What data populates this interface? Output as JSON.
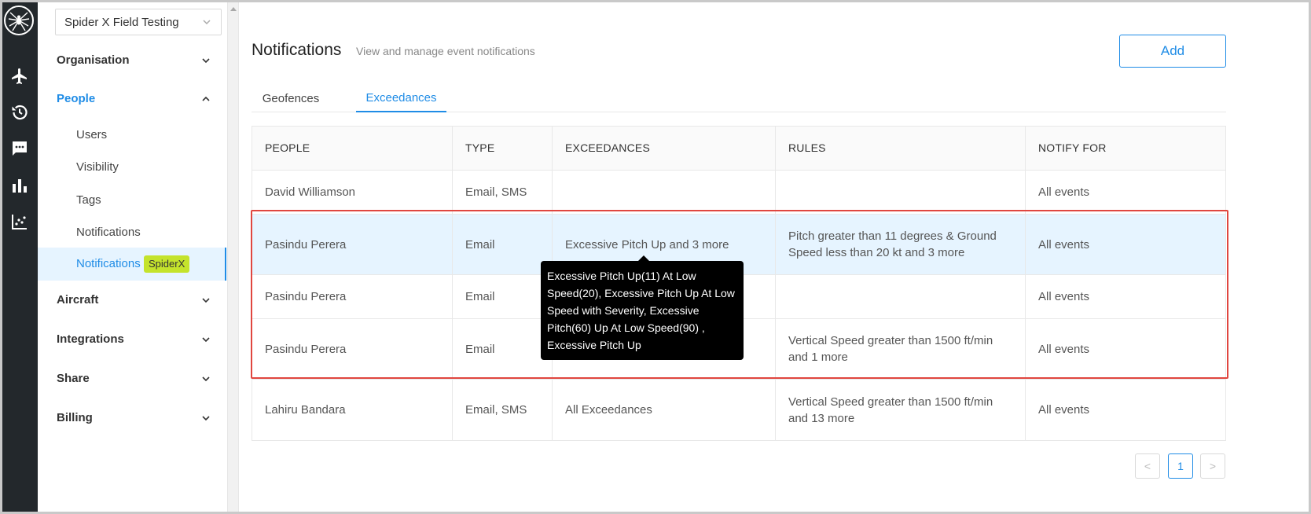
{
  "org_selector": {
    "value": "Spider X Field Testing"
  },
  "sidebar": {
    "groups": {
      "organisation": "Organisation",
      "people": "People",
      "aircraft": "Aircraft",
      "integrations": "Integrations",
      "share": "Share",
      "billing": "Billing"
    },
    "people_items": [
      "Users",
      "Visibility",
      "Tags",
      "Notifications"
    ],
    "active_item": {
      "label": "Notifications",
      "badge": "SpiderX"
    }
  },
  "rail_icons": [
    "spider-logo",
    "plane-icon",
    "history-icon",
    "chat-icon",
    "bar-chart-icon",
    "scatter-chart-icon"
  ],
  "header": {
    "title": "Notifications",
    "subtitle": "View and manage event notifications",
    "add_label": "Add"
  },
  "tabs": [
    {
      "label": "Geofences",
      "active": false
    },
    {
      "label": "Exceedances",
      "active": true
    }
  ],
  "table": {
    "columns": [
      "PEOPLE",
      "TYPE",
      "EXCEEDANCES",
      "RULES",
      "NOTIFY FOR"
    ],
    "rows": [
      {
        "people": "David Williamson",
        "type": "Email, SMS",
        "exceedances": "",
        "rules": "",
        "notify": "All events"
      },
      {
        "people": "Pasindu Perera",
        "type": "Email",
        "exceedances": "Excessive Pitch Up and 3 more",
        "rules": "Pitch greater than 11 degrees & Ground Speed less than 20 kt and 3 more",
        "notify": "All events"
      },
      {
        "people": "Pasindu Perera",
        "type": "Email",
        "exceedances": "",
        "rules": "",
        "notify": "All events"
      },
      {
        "people": "Pasindu Perera",
        "type": "Email",
        "exceedances": "",
        "rules": "Vertical Speed greater than 1500 ft/min and 1 more",
        "notify": "All events"
      },
      {
        "people": "Lahiru Bandara",
        "type": "Email, SMS",
        "exceedances": "All Exceedances",
        "rules": "Vertical Speed greater than 1500 ft/min and 13 more",
        "notify": "All events"
      }
    ]
  },
  "tooltip": "Excessive Pitch Up(11) At Low Speed(20), Excessive Pitch Up At Low Speed with Severity, Excessive Pitch(60) Up At Low Speed(90) , Excessive Pitch Up",
  "pagination": {
    "prev": "<",
    "current": "1",
    "next": ">"
  },
  "colors": {
    "accent": "#1f8ce6",
    "rail": "#23282c",
    "badge": "#c4e32c",
    "highlight": "#e0463f"
  }
}
